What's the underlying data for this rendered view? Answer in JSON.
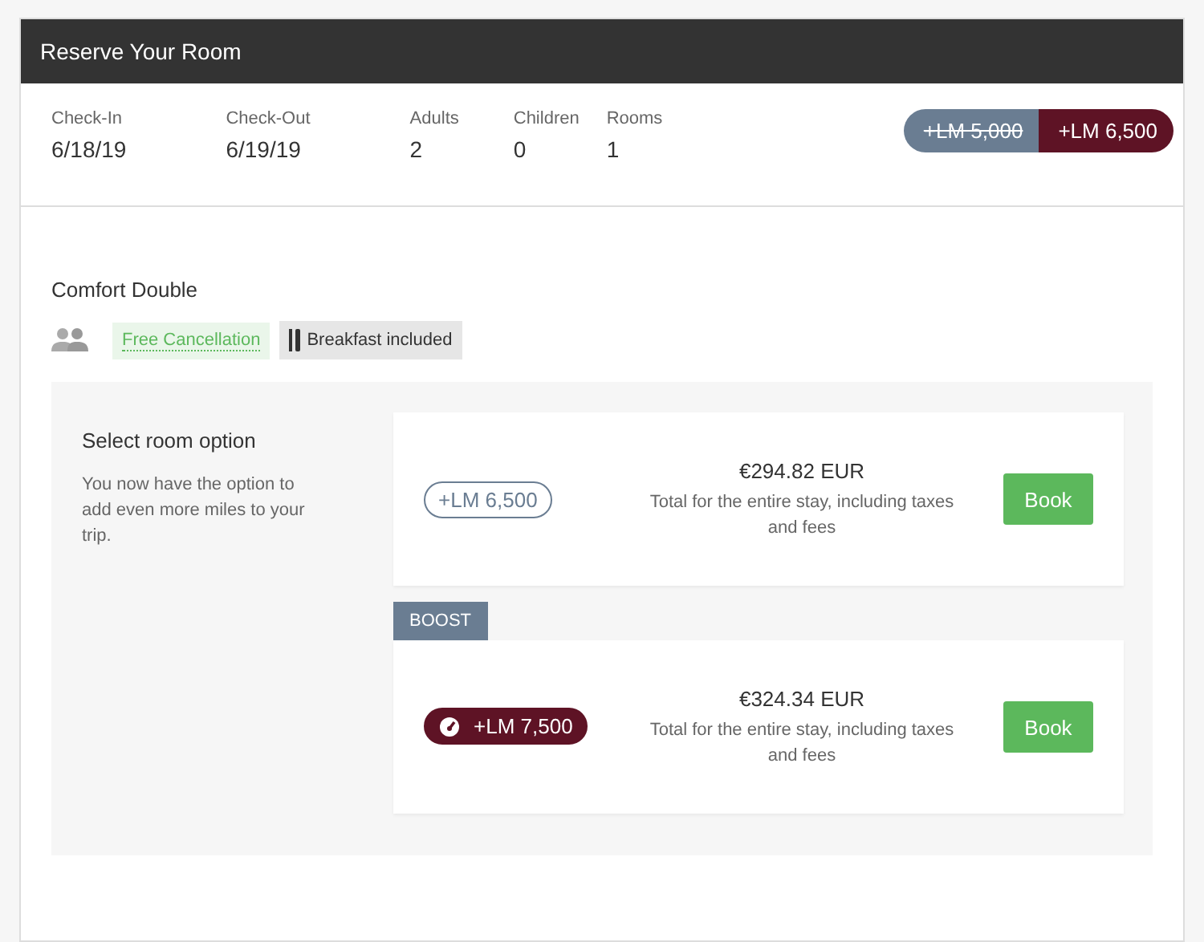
{
  "header": {
    "title": "Reserve Your Room"
  },
  "stay": [
    {
      "label": "Check-In",
      "value": "6/18/19"
    },
    {
      "label": "Check-Out",
      "value": "6/19/19"
    },
    {
      "label": "Adults",
      "value": "2"
    },
    {
      "label": "Children",
      "value": "0"
    },
    {
      "label": "Rooms",
      "value": "1"
    }
  ],
  "miles": {
    "old": "+LM 5,000",
    "new": "+LM 6,500"
  },
  "room": {
    "name": "Comfort Double",
    "amenities": [
      {
        "kind": "cancellation",
        "label": "Free Cancellation"
      },
      {
        "kind": "breakfast",
        "label": "Breakfast included"
      }
    ]
  },
  "options_intro": {
    "title": "Select room option",
    "text": "You now have the option to add even more miles to your trip."
  },
  "options": [
    {
      "kind": "standard",
      "miles": "+LM 6,500",
      "price": "€294.82 EUR",
      "note": "Total for the entire stay, including taxes and fees",
      "button": "Book"
    },
    {
      "kind": "boost",
      "badge": "BOOST",
      "miles": "+LM 7,500",
      "price": "€324.34 EUR",
      "note": "Total for the entire stay, including taxes and fees",
      "button": "Book"
    }
  ]
}
